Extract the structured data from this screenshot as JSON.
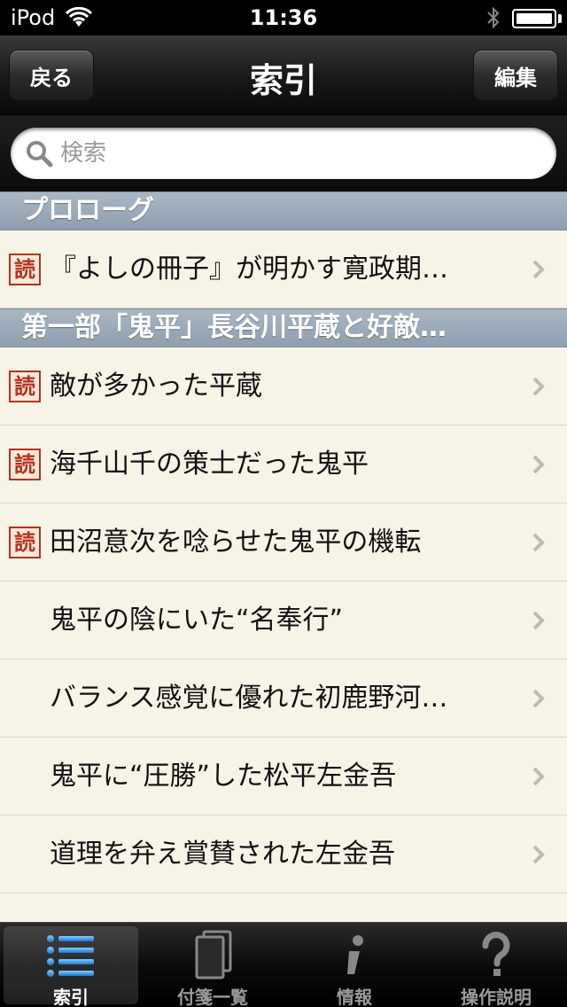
{
  "status_bar": {
    "device": "iPod",
    "time": "11:36"
  },
  "nav": {
    "back_label": "戻る",
    "title": "索引",
    "edit_label": "編集"
  },
  "search": {
    "placeholder": "検索"
  },
  "list": {
    "badge": "読",
    "sections": [
      {
        "title": "プロローグ",
        "rows": [
          {
            "label": "『よしの冊子』が明かす寛政期…",
            "badge": true
          }
        ]
      },
      {
        "title": "第一部「鬼平」長谷川平蔵と好敵…",
        "rows": [
          {
            "label": "敵が多かった平蔵",
            "badge": true
          },
          {
            "label": "海千山千の策士だった鬼平",
            "badge": true
          },
          {
            "label": "田沼意次を唸らせた鬼平の機転",
            "badge": true
          },
          {
            "label": "鬼平の陰にいた“名奉行”",
            "badge": false
          },
          {
            "label": "バランス感覚に優れた初鹿野河…",
            "badge": false
          },
          {
            "label": "鬼平に“圧勝”した松平左金吾",
            "badge": false
          },
          {
            "label": "道理を弁え賞賛された左金吾",
            "badge": false
          }
        ]
      }
    ]
  },
  "tabs": [
    {
      "label": "索引",
      "icon": "list-icon",
      "active": true
    },
    {
      "label": "付箋一覧",
      "icon": "bookmark-pages-icon",
      "active": false
    },
    {
      "label": "情報",
      "icon": "info-icon",
      "active": false
    },
    {
      "label": "操作説明",
      "icon": "question-icon",
      "active": false
    }
  ],
  "colors": {
    "badge_red": "#b3331f",
    "section_blue": "#9aaabb",
    "paper": "#f6f3e7"
  }
}
